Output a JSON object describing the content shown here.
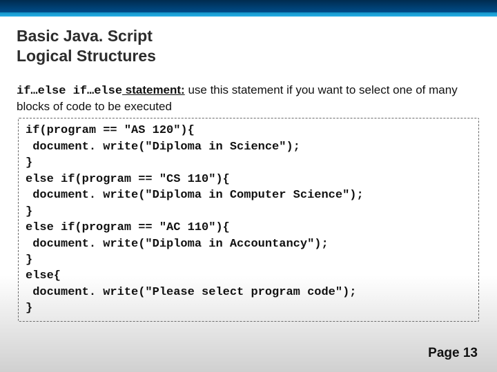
{
  "header": {
    "title": "Basic Java. Script\nLogical Structures"
  },
  "body": {
    "keyword": "if…else if…else",
    "desc_label": " statement:",
    "desc_text": " use this statement if you want to select one of many blocks of code to be executed",
    "code": "if(program == \"AS 120\"){\n document. write(\"Diploma in Science\");\n}\nelse if(program == \"CS 110\"){\n document. write(\"Diploma in Computer Science\");\n}\nelse if(program == \"AC 110\"){\n document. write(\"Diploma in Accountancy\");\n}\nelse{\n document. write(\"Please select program code\");\n}"
  },
  "footer": {
    "page_label": "Page 13"
  }
}
